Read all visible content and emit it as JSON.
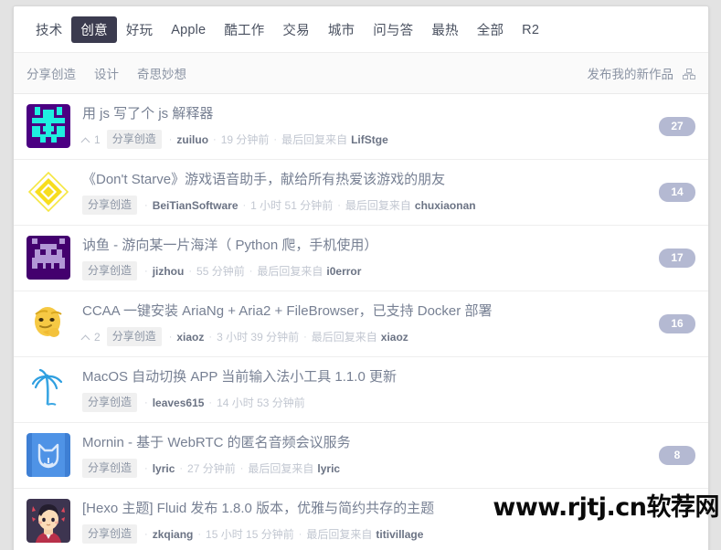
{
  "nav": {
    "tabs": [
      {
        "label": "技术",
        "active": false
      },
      {
        "label": "创意",
        "active": true
      },
      {
        "label": "好玩",
        "active": false
      },
      {
        "label": "Apple",
        "active": false
      },
      {
        "label": "酷工作",
        "active": false
      },
      {
        "label": "交易",
        "active": false
      },
      {
        "label": "城市",
        "active": false
      },
      {
        "label": "问与答",
        "active": false
      },
      {
        "label": "最热",
        "active": false
      },
      {
        "label": "全部",
        "active": false
      },
      {
        "label": "R2",
        "active": false
      }
    ],
    "active_tab_bg": "#3b3b4f",
    "active_tab_color": "#ffffff"
  },
  "subnav": {
    "items": [
      {
        "label": "分享创造"
      },
      {
        "label": "设计"
      },
      {
        "label": "奇思妙想"
      }
    ],
    "publish_label": "发布我的新作品",
    "grid_icon": "grid-icon"
  },
  "topics": [
    {
      "title": "用 js 写了个 js 解释器",
      "votes": "1",
      "node": "分享创造",
      "user": "zuiluo",
      "time": "19 分钟前",
      "reply_prefix": "最后回复来自",
      "reply_user": "LifStge",
      "count": "27",
      "avatar": "pixel-invader-cyan"
    },
    {
      "title": "《Don't Starve》游戏语音助手，献给所有热爱该游戏的朋友",
      "votes": "",
      "node": "分享创造",
      "user": "BeiTianSoftware",
      "time": "1 小时 51 分钟前",
      "reply_prefix": "最后回复来自",
      "reply_user": "chuxiaonan",
      "count": "14",
      "avatar": "yellow-diamond"
    },
    {
      "title": "讷鱼 - 游向某一片海洋（ Python 爬，手机使用）",
      "votes": "",
      "node": "分享创造",
      "user": "jizhou",
      "time": "55 分钟前",
      "reply_prefix": "最后回复来自",
      "reply_user": "i0error",
      "count": "17",
      "avatar": "pixel-invader-purple"
    },
    {
      "title": "CCAA 一键安装 AriaNg + Aria2 + FileBrowser，已支持 Docker 部署",
      "votes": "2",
      "node": "分享创造",
      "user": "xiaoz",
      "time": "3 小时 39 分钟前",
      "reply_prefix": "最后回复来自",
      "reply_user": "xiaoz",
      "count": "16",
      "avatar": "thinking-face"
    },
    {
      "title": "MacOS 自动切换 APP 当前输入法小工具 1.1.0 更新",
      "votes": "",
      "node": "分享创造",
      "user": "leaves615",
      "time": "14 小时 53 分钟前",
      "reply_prefix": "",
      "reply_user": "",
      "count": "",
      "avatar": "palm-tree"
    },
    {
      "title": "Mornin - 基于 WebRTC 的匿名音频会议服务",
      "votes": "",
      "node": "分享创造",
      "user": "lyric",
      "time": "27 分钟前",
      "reply_prefix": "最后回复来自",
      "reply_user": "lyric",
      "count": "8",
      "avatar": "blue-cat"
    },
    {
      "title": "[Hexo 主题] Fluid 发布 1.8.0 版本，优雅与简约共存的主题",
      "votes": "",
      "node": "分享创造",
      "user": "zkqiang",
      "time": "15 小时 15 分钟前",
      "reply_prefix": "最后回复来自",
      "reply_user": "titivillage",
      "count": "",
      "avatar": "anime-boy"
    }
  ],
  "watermark": {
    "text": "www.rjtj.cn软荐网"
  },
  "colors": {
    "page_bg": "#e3e3e3",
    "card_bg": "#ffffff",
    "badge_bg": "#b4b9d2",
    "title": "#778093",
    "meta": "#b3b9c4",
    "node_tag_bg": "#f0f0f0"
  }
}
